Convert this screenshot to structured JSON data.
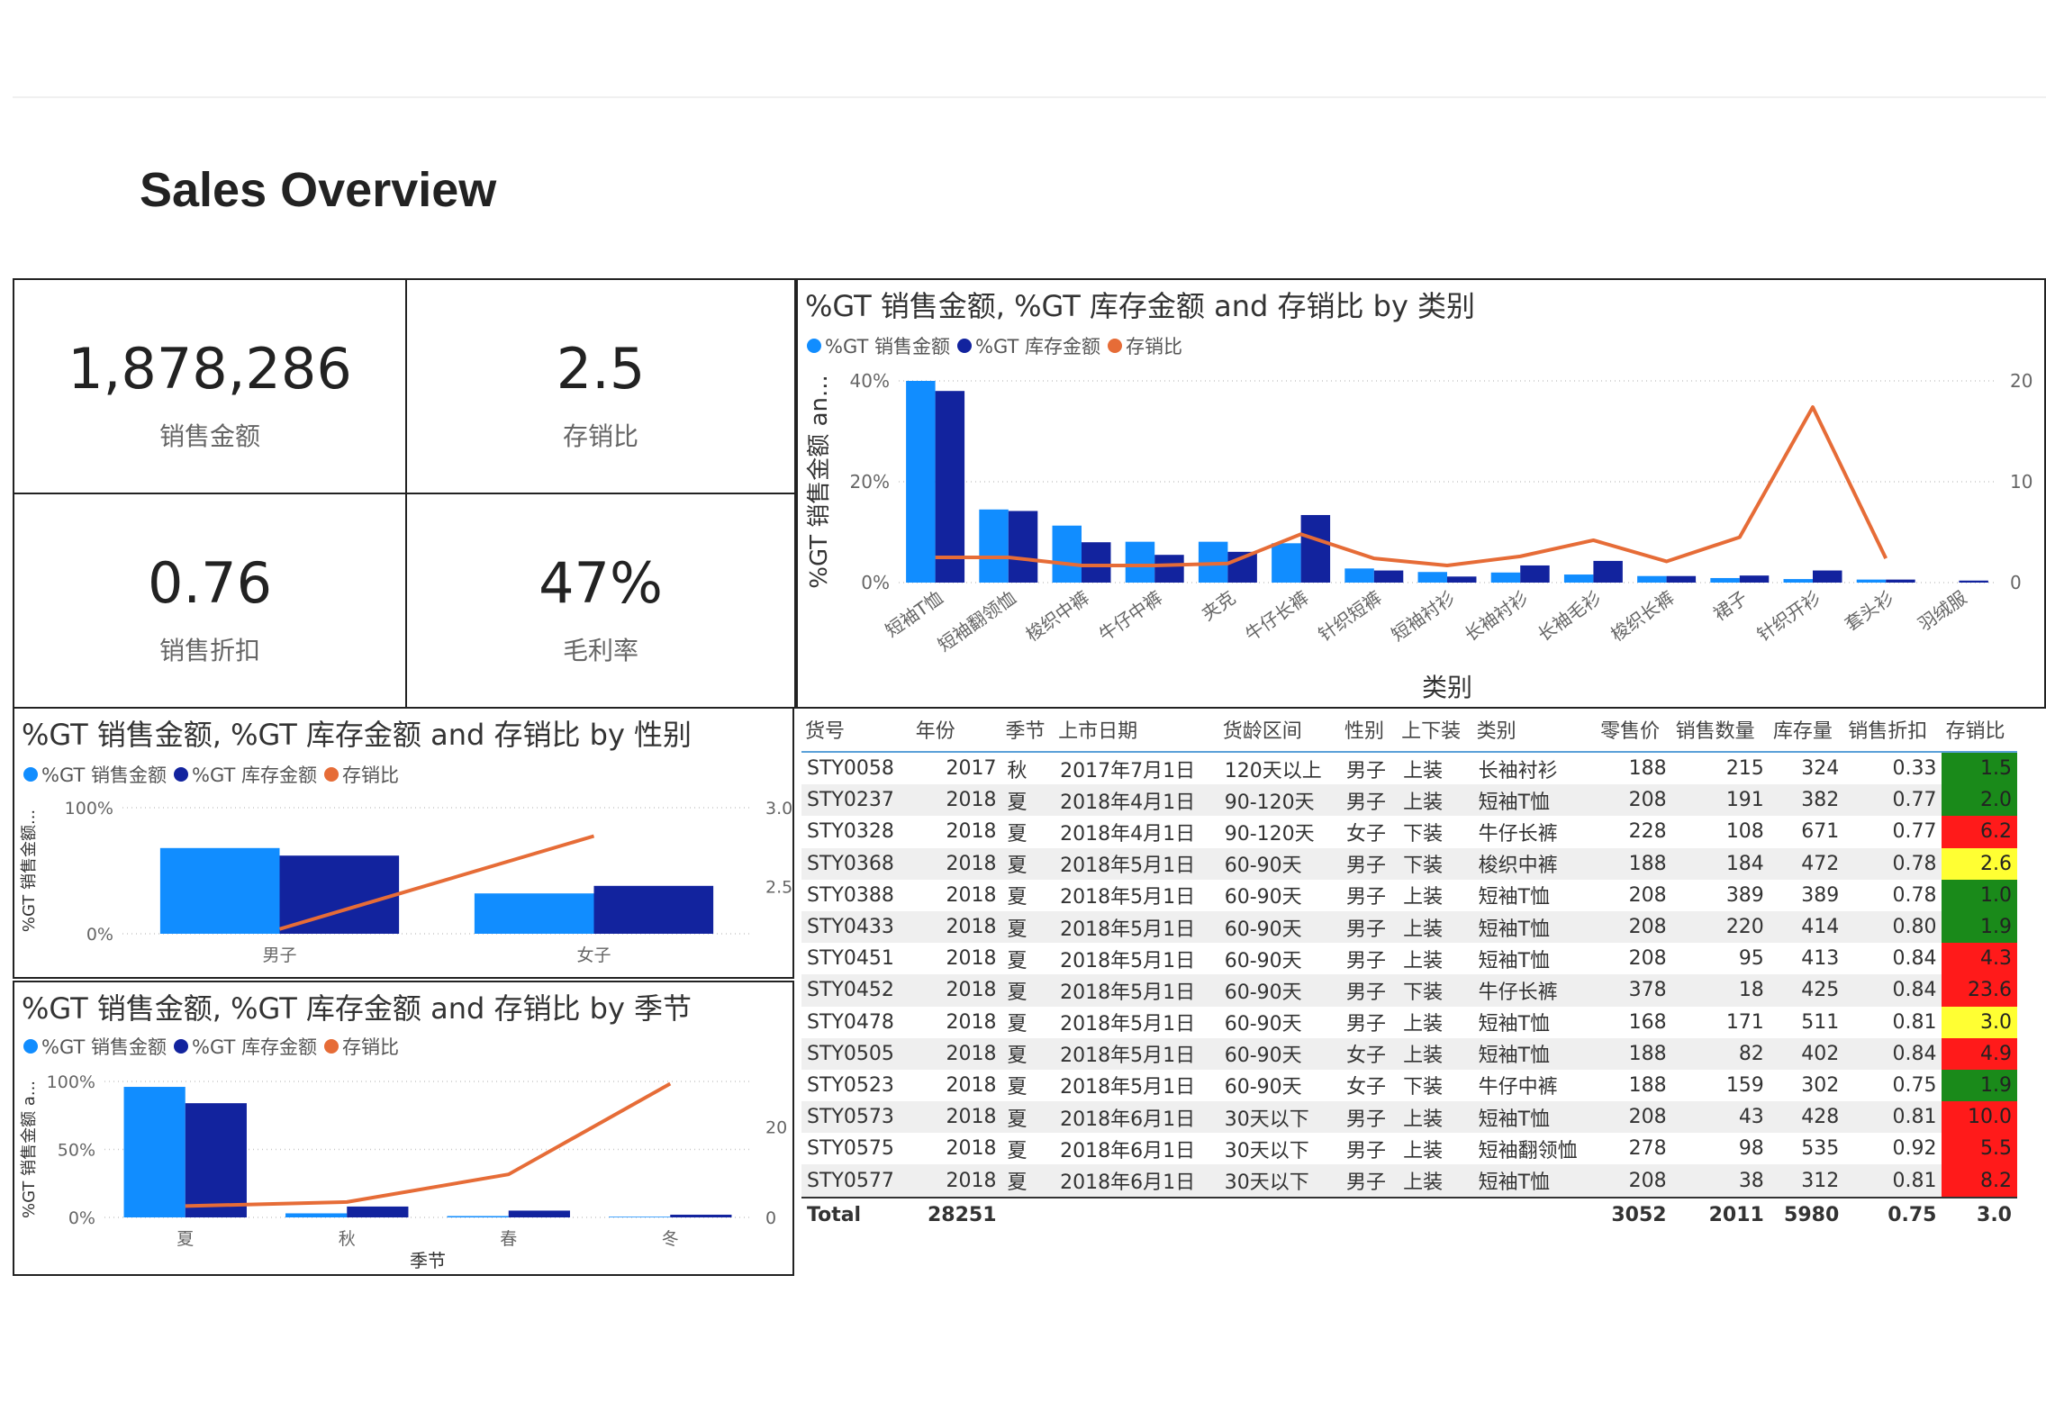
{
  "page": {
    "title": "Sales Overview"
  },
  "kpis": {
    "sales": {
      "value": "1,878,286",
      "label": "销售金额"
    },
    "ratio": {
      "value": "2.5",
      "label": "存销比"
    },
    "discount": {
      "value": "0.76",
      "label": "销售折扣"
    },
    "margin": {
      "value": "47%",
      "label": "毛利率"
    }
  },
  "colors": {
    "sales": "#118dff",
    "inventory": "#12239e",
    "ratio": "#e66c37",
    "cell_green": "#1a8a1a",
    "cell_yellow": "#ffff33",
    "cell_red": "#ff1a1a"
  },
  "legend": {
    "sales": "%GT 销售金额",
    "inventory": "%GT 库存金额",
    "ratio": "存销比"
  },
  "chart_data": [
    {
      "id": "category",
      "type": "bar",
      "title": "%GT 销售金额, %GT 库存金额 and 存销比 by 类别",
      "xlabel": "类别",
      "ylabel": "%GT 销售金额 an...",
      "ylim": [
        0,
        40
      ],
      "y_ticks": [
        "0%",
        "20%",
        "40%"
      ],
      "y2lim": [
        0,
        20
      ],
      "y2_ticks": [
        "0",
        "10",
        "20"
      ],
      "categories": [
        "短袖T恤",
        "短袖翻领恤",
        "梭织中裤",
        "牛仔中裤",
        "夹克",
        "牛仔长裤",
        "针织短裤",
        "短袖衬衫",
        "长袖衬衫",
        "长袖毛衫",
        "梭织长裤",
        "裙子",
        "针织开衫",
        "套头衫",
        "羽绒服"
      ],
      "series": [
        {
          "name": "%GT 销售金额",
          "values": [
            40.0,
            14.5,
            11.3,
            8.1,
            8.1,
            7.8,
            2.8,
            2.1,
            2.0,
            1.6,
            1.3,
            0.9,
            0.7,
            0.6,
            0.0
          ]
        },
        {
          "name": "%GT 库存金额",
          "values": [
            38.0,
            14.2,
            8.0,
            5.5,
            6.1,
            13.4,
            2.4,
            1.2,
            3.4,
            4.3,
            1.3,
            1.4,
            2.4,
            0.6,
            0.4
          ]
        },
        {
          "name": "存销比",
          "axis": "secondary",
          "values": [
            2.5,
            2.5,
            1.7,
            1.7,
            1.9,
            4.8,
            2.4,
            1.7,
            2.6,
            4.2,
            2.1,
            4.5,
            17.4,
            2.4,
            null
          ]
        }
      ]
    },
    {
      "id": "gender",
      "type": "bar",
      "title": "%GT 销售金额, %GT 库存金额 and 存销比 by 性别",
      "ylabel": "%GT 销售金额...",
      "ylim": [
        0,
        100
      ],
      "y_ticks": [
        "0%",
        "100%"
      ],
      "y2lim": [
        2.2,
        3.0
      ],
      "y2_ticks": [
        "2.5",
        "3.0"
      ],
      "categories": [
        "男子",
        "女子"
      ],
      "series": [
        {
          "name": "%GT 销售金额",
          "values": [
            68,
            32
          ]
        },
        {
          "name": "%GT 库存金额",
          "values": [
            62,
            38
          ]
        },
        {
          "name": "存销比",
          "axis": "secondary",
          "values": [
            2.23,
            2.82
          ]
        }
      ]
    },
    {
      "id": "season",
      "type": "bar",
      "title": "%GT 销售金额, %GT 库存金额 and 存销比 by 季节",
      "xlabel": "季节",
      "ylabel": "%GT 销售金额 a...",
      "ylim": [
        0,
        100
      ],
      "y_ticks": [
        "0%",
        "50%",
        "100%"
      ],
      "y2lim": [
        0,
        30
      ],
      "y2_ticks": [
        "0",
        "20"
      ],
      "categories": [
        "夏",
        "秋",
        "春",
        "冬"
      ],
      "series": [
        {
          "name": "%GT 销售金额",
          "values": [
            96,
            3,
            1,
            0.5
          ]
        },
        {
          "name": "%GT 库存金额",
          "values": [
            84,
            8,
            5,
            2
          ]
        },
        {
          "name": "存销比",
          "axis": "secondary",
          "values": [
            2.5,
            3.4,
            9.5,
            29.5
          ]
        }
      ]
    }
  ],
  "table": {
    "headers": [
      "货号",
      "年份",
      "季节",
      "上市日期",
      "货龄区间",
      "性别",
      "上下装",
      "类别",
      "零售价",
      "销售数量",
      "库存量",
      "销售折扣",
      "存销比"
    ],
    "rows": [
      [
        "STY0058",
        "2017",
        "秋",
        "2017年7月1日",
        "120天以上",
        "男子",
        "上装",
        "长袖衬衫",
        "188",
        "215",
        "324",
        "0.33",
        "1.5",
        "green"
      ],
      [
        "STY0237",
        "2018",
        "夏",
        "2018年4月1日",
        "90-120天",
        "男子",
        "上装",
        "短袖T恤",
        "208",
        "191",
        "382",
        "0.77",
        "2.0",
        "green"
      ],
      [
        "STY0328",
        "2018",
        "夏",
        "2018年4月1日",
        "90-120天",
        "女子",
        "下装",
        "牛仔长裤",
        "228",
        "108",
        "671",
        "0.77",
        "6.2",
        "red"
      ],
      [
        "STY0368",
        "2018",
        "夏",
        "2018年5月1日",
        "60-90天",
        "男子",
        "下装",
        "梭织中裤",
        "188",
        "184",
        "472",
        "0.78",
        "2.6",
        "yellow"
      ],
      [
        "STY0388",
        "2018",
        "夏",
        "2018年5月1日",
        "60-90天",
        "男子",
        "上装",
        "短袖T恤",
        "208",
        "389",
        "389",
        "0.78",
        "1.0",
        "green"
      ],
      [
        "STY0433",
        "2018",
        "夏",
        "2018年5月1日",
        "60-90天",
        "男子",
        "上装",
        "短袖T恤",
        "208",
        "220",
        "414",
        "0.80",
        "1.9",
        "green"
      ],
      [
        "STY0451",
        "2018",
        "夏",
        "2018年5月1日",
        "60-90天",
        "男子",
        "上装",
        "短袖T恤",
        "208",
        "95",
        "413",
        "0.84",
        "4.3",
        "red"
      ],
      [
        "STY0452",
        "2018",
        "夏",
        "2018年5月1日",
        "60-90天",
        "男子",
        "下装",
        "牛仔长裤",
        "378",
        "18",
        "425",
        "0.84",
        "23.6",
        "red"
      ],
      [
        "STY0478",
        "2018",
        "夏",
        "2018年5月1日",
        "60-90天",
        "男子",
        "上装",
        "短袖T恤",
        "168",
        "171",
        "511",
        "0.81",
        "3.0",
        "yellow"
      ],
      [
        "STY0505",
        "2018",
        "夏",
        "2018年5月1日",
        "60-90天",
        "女子",
        "上装",
        "短袖T恤",
        "188",
        "82",
        "402",
        "0.84",
        "4.9",
        "red"
      ],
      [
        "STY0523",
        "2018",
        "夏",
        "2018年5月1日",
        "60-90天",
        "女子",
        "下装",
        "牛仔中裤",
        "188",
        "159",
        "302",
        "0.75",
        "1.9",
        "green"
      ],
      [
        "STY0573",
        "2018",
        "夏",
        "2018年6月1日",
        "30天以下",
        "男子",
        "上装",
        "短袖T恤",
        "208",
        "43",
        "428",
        "0.81",
        "10.0",
        "red"
      ],
      [
        "STY0575",
        "2018",
        "夏",
        "2018年6月1日",
        "30天以下",
        "男子",
        "上装",
        "短袖翻领恤",
        "278",
        "98",
        "535",
        "0.92",
        "5.5",
        "red"
      ],
      [
        "STY0577",
        "2018",
        "夏",
        "2018年6月1日",
        "30天以下",
        "男子",
        "上装",
        "短袖T恤",
        "208",
        "38",
        "312",
        "0.81",
        "8.2",
        "red"
      ]
    ],
    "total": {
      "label": "Total",
      "year": "28251",
      "price": "3052",
      "qty": "2011",
      "stock": "5980",
      "discount": "0.75",
      "ratio": "3.0"
    }
  }
}
